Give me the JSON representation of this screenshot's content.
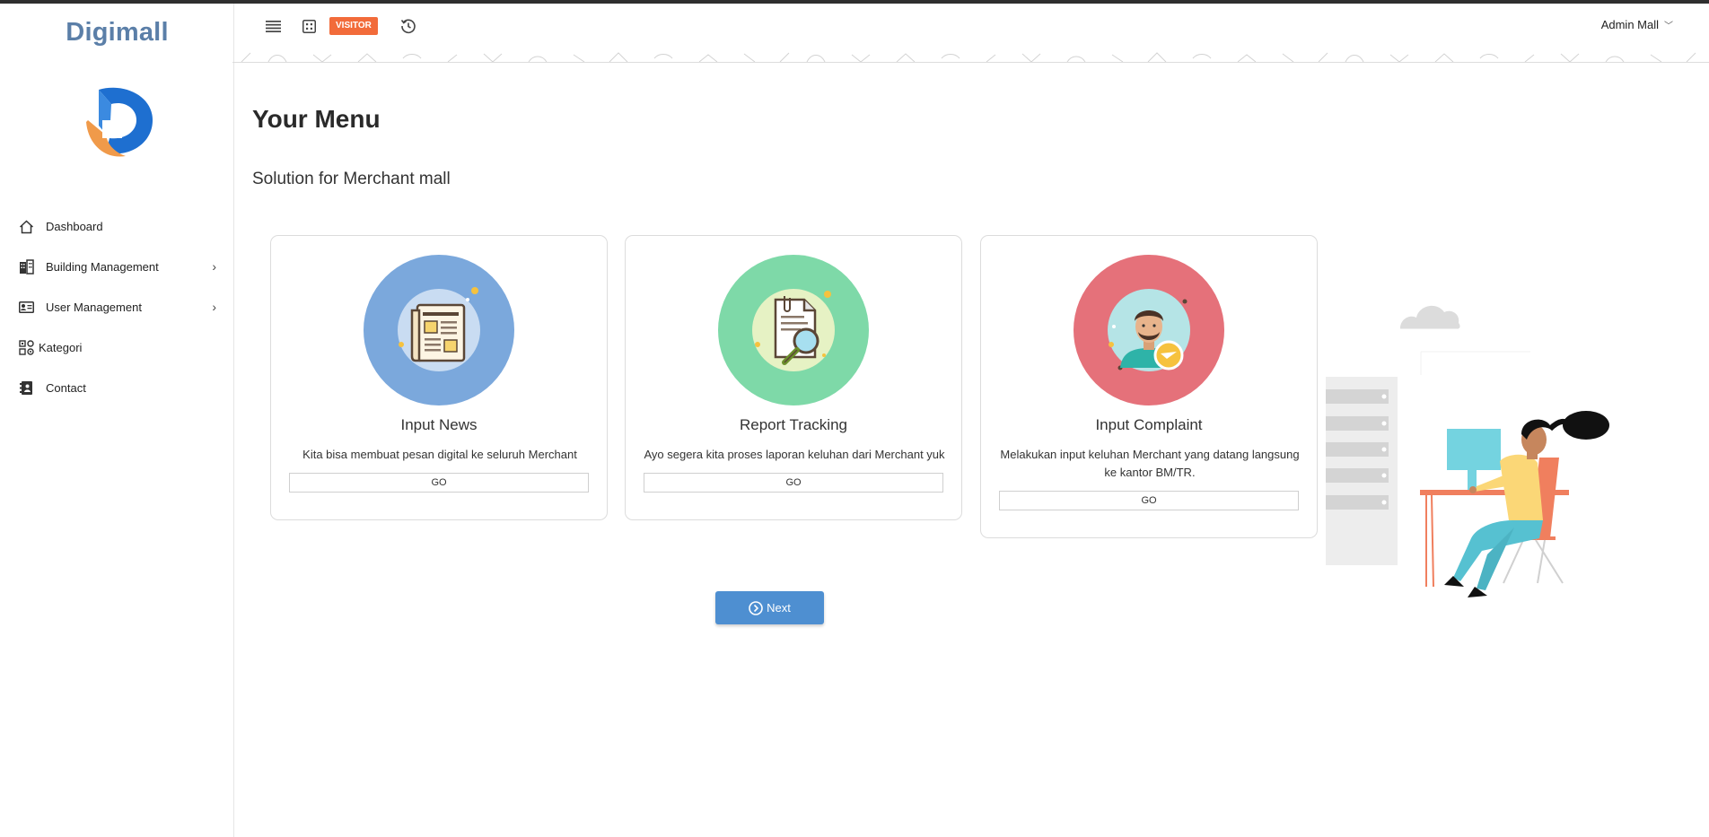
{
  "app": {
    "brand": "Digimall"
  },
  "colors": {
    "accent": "#4e8fd1",
    "brand": "#5b7fa8",
    "badge": "#f26b3a",
    "news": "#7ba8dc",
    "tracking": "#7ed9a8",
    "complaint": "#e5717a"
  },
  "sidebar": {
    "items": [
      {
        "label": "Dashboard",
        "icon": "home-icon",
        "has_submenu": false
      },
      {
        "label": "Building Management",
        "icon": "building-icon",
        "has_submenu": true
      },
      {
        "label": "User Management",
        "icon": "id-card-icon",
        "has_submenu": true
      },
      {
        "label": "Kategori",
        "icon": "category-icon",
        "has_submenu": false
      },
      {
        "label": "Contact",
        "icon": "contact-book-icon",
        "has_submenu": false
      }
    ]
  },
  "header": {
    "menu_icon": "hamburger-icon",
    "grid_icon": "grid-icon",
    "visitor_label": "VISITOR",
    "history_icon": "history-icon",
    "user_name": "Admin Mall"
  },
  "main": {
    "title": "Your Menu",
    "subtitle": "Solution for Merchant mall",
    "cards": [
      {
        "title": "Input News",
        "description": "Kita bisa membuat pesan digital ke seluruh Merchant",
        "button": "GO",
        "icon": "newspaper-icon"
      },
      {
        "title": "Report Tracking",
        "description": "Ayo segera kita proses laporan keluhan dari Merchant yuk",
        "button": "GO",
        "icon": "document-search-icon"
      },
      {
        "title": "Input Complaint",
        "description": "Melakukan input keluhan Merchant yang datang langsung ke kantor BM/TR.",
        "button": "GO",
        "icon": "support-agent-icon"
      }
    ],
    "next_label": "Next"
  }
}
